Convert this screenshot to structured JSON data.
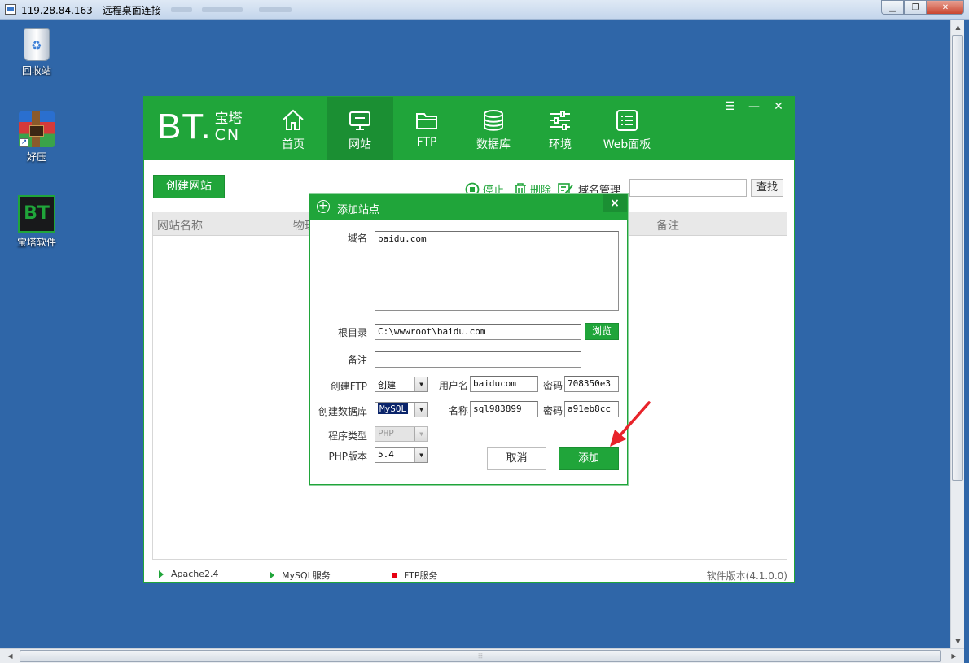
{
  "rdp": {
    "title": "119.28.84.163 - 远程桌面连接",
    "minimize": "▁",
    "restore": "❐",
    "close": "✕"
  },
  "desktop": {
    "icons": [
      {
        "label": "回收站",
        "icon": "recycle-bin-icon"
      },
      {
        "label": "好压",
        "icon": "archive-icon"
      },
      {
        "label": "宝塔软件",
        "icon": "bt-panel-icon",
        "glyph": "BT"
      }
    ],
    "shortcut_glyph": "↗"
  },
  "bt": {
    "logo_main": "BT.",
    "logo_cn_top": "宝塔",
    "logo_cn_bottom": "CN",
    "nav": [
      {
        "label": "首页",
        "icon": "home-icon"
      },
      {
        "label": "网站",
        "icon": "monitor-icon",
        "active": true
      },
      {
        "label": "FTP",
        "icon": "folder-icon"
      },
      {
        "label": "数据库",
        "icon": "database-icon"
      },
      {
        "label": "环境",
        "icon": "sliders-icon"
      },
      {
        "label": "Web面板",
        "icon": "list-icon"
      }
    ],
    "window_controls": {
      "menu": "☰",
      "minimize": "—",
      "close": "✕"
    },
    "toolbar": {
      "create_site": "创建网站",
      "stop": "停止",
      "delete": "删除",
      "domain_manage": "域名管理",
      "search_value": "",
      "find": "查找"
    },
    "columns": [
      "网站名称",
      "物理",
      "备注"
    ],
    "status": {
      "apache": "Apache2.4",
      "mysql": "MySQL服务",
      "ftp": "FTP服务",
      "version": "软件版本(4.1.0.0)"
    },
    "accent": "#20a53a",
    "ftp_stopped_color": "#e60012"
  },
  "dialog": {
    "title": "添加站点",
    "close": "×",
    "labels": {
      "domain": "域名",
      "root": "根目录",
      "note": "备注",
      "create_ftp": "创建FTP",
      "ftp_user": "用户名",
      "ftp_pass": "密码",
      "create_db": "创建数据库",
      "db_name": "名称",
      "db_pass": "密码",
      "program_type": "程序类型",
      "php_version": "PHP版本"
    },
    "values": {
      "domain": "baidu.com",
      "root": "C:\\wwwroot\\baidu.com",
      "note": "",
      "create_ftp": "创建",
      "ftp_user": "baiducom",
      "ftp_pass": "708350e3",
      "create_db": "MySQL",
      "db_name": "sql983899",
      "db_pass": "a91eb8cc",
      "program_type": "PHP",
      "php_version": "5.4"
    },
    "browse": "浏览",
    "cancel": "取消",
    "add": "添加"
  }
}
